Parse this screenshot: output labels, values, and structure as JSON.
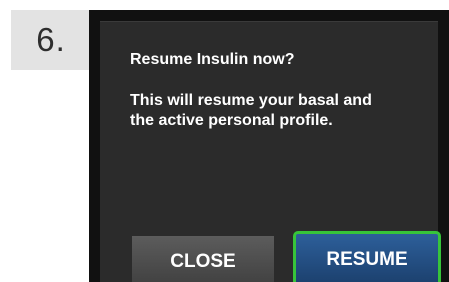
{
  "step": {
    "number": "6."
  },
  "dialog": {
    "title": "Resume Insulin now?",
    "message_line1": "This will resume your basal and",
    "message_line2": "the active personal profile."
  },
  "buttons": {
    "close_label": "CLOSE",
    "resume_label": "RESUME"
  },
  "colors": {
    "resume_button": "#1f4a7d",
    "resume_border_highlight": "#37c43a",
    "close_button": "#4d4d4d",
    "dialog_background": "#2b2b2b"
  }
}
